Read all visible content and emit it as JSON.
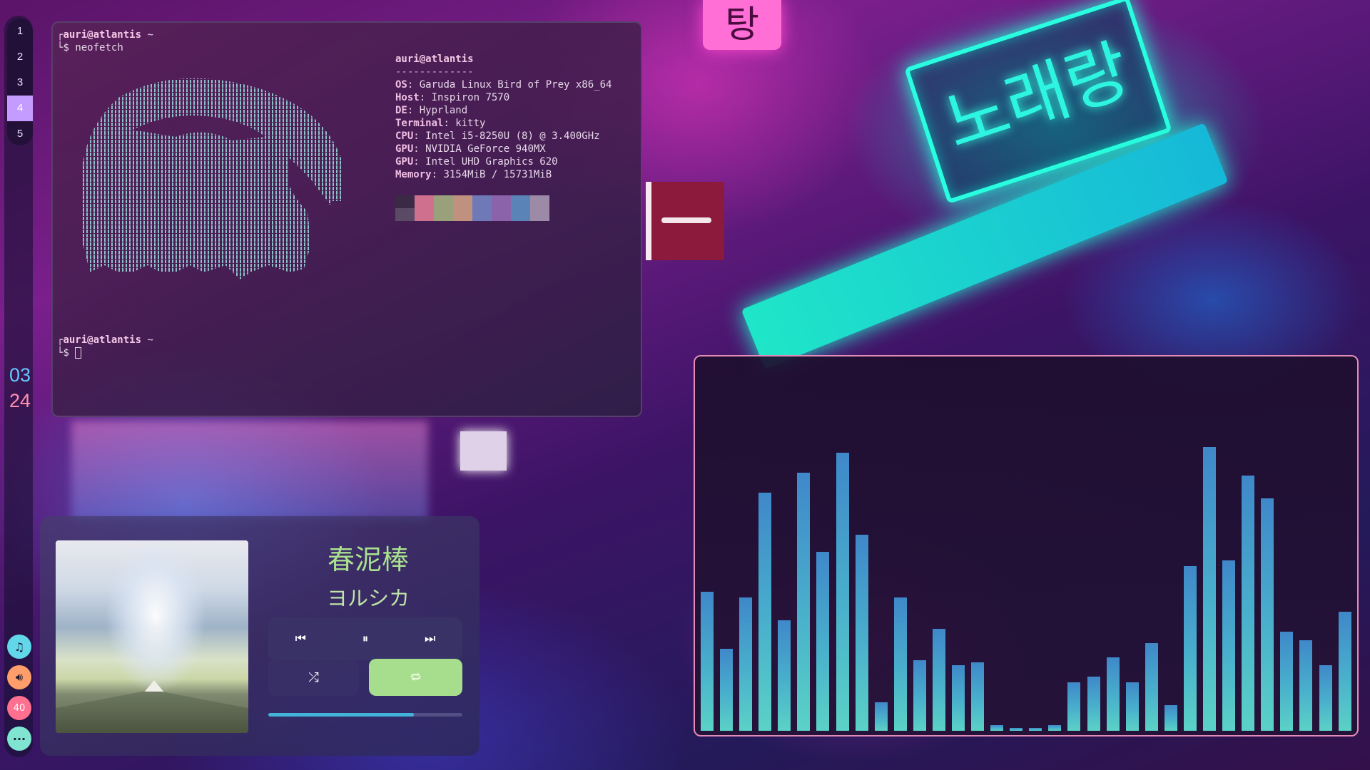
{
  "workspaces": [
    {
      "label": "1",
      "active": false
    },
    {
      "label": "2",
      "active": false
    },
    {
      "label": "3",
      "active": false
    },
    {
      "label": "4",
      "active": true
    },
    {
      "label": "5",
      "active": false
    }
  ],
  "clock": {
    "hour": "03",
    "minute": "24"
  },
  "tray": {
    "music_icon": "music-note-icon",
    "volume_icon": "speaker-icon",
    "battery_label": "40",
    "more_icon": "ellipsis-icon"
  },
  "terminal": {
    "prompt_user": "auri@atlantis",
    "prompt_dir": "~",
    "command": "neofetch",
    "prompt_symbol": "$",
    "info_title": "auri@atlantis",
    "info_divider": "-------------",
    "info": [
      {
        "key": "OS",
        "value": "Garuda Linux Bird of Prey x86_64"
      },
      {
        "key": "Host",
        "value": "Inspiron 7570"
      },
      {
        "key": "DE",
        "value": "Hyprland"
      },
      {
        "key": "Terminal",
        "value": "kitty"
      },
      {
        "key": "CPU",
        "value": "Intel i5-8250U (8) @ 3.400GHz"
      },
      {
        "key": "GPU",
        "value": "NVIDIA GeForce 940MX"
      },
      {
        "key": "GPU",
        "value": "Intel UHD Graphics 620"
      },
      {
        "key": "Memory",
        "value": "3154MiB / 15731MiB"
      }
    ],
    "palette_top": [
      "#3a2a46",
      "#d0708f",
      "#9aa07a",
      "#c0917f",
      "#6f79b8",
      "#8b63aa",
      "#5a84b8",
      "#9c8aa6"
    ],
    "palette_bottom": [
      "#5a4a66",
      "#d0708f",
      "#9aa07a",
      "#c0917f",
      "#6f79b8",
      "#8b63aa",
      "#5a84b8",
      "#9c8aa6"
    ]
  },
  "player": {
    "title": "春泥棒",
    "artist": "ヨルシカ",
    "progress": 0.75,
    "prev_icon": "skip-previous-icon",
    "pause_icon": "pause-icon",
    "next_icon": "skip-next-icon",
    "shuffle_icon": "shuffle-icon",
    "repeat_icon": "repeat-icon"
  },
  "visualizer": {
    "levels": [
      0.49,
      0.29,
      0.47,
      0.84,
      0.39,
      0.91,
      0.63,
      0.98,
      0.69,
      0.1,
      0.47,
      0.25,
      0.36,
      0.23,
      0.24,
      0.02,
      0.01,
      0.01,
      0.02,
      0.17,
      0.19,
      0.26,
      0.17,
      0.31,
      0.09,
      0.58,
      1.0,
      0.6,
      0.9,
      0.82,
      0.35,
      0.32,
      0.23,
      0.42
    ]
  }
}
